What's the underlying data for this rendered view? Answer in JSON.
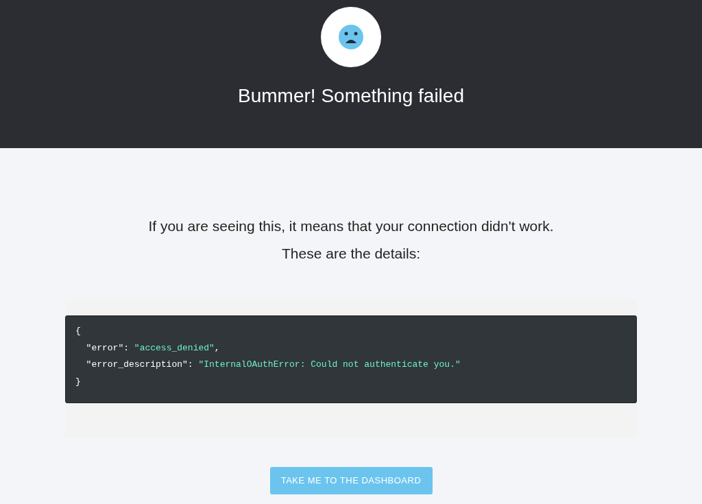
{
  "header": {
    "title": "Bummer! Something failed"
  },
  "message": [
    "If you are seeing this, it means that your connection didn't work.",
    "These are the details:"
  ],
  "code": [
    [
      {
        "kind": "punct",
        "text": "{"
      }
    ],
    [
      {
        "kind": "key",
        "text": "  \"error\""
      },
      {
        "kind": "punct",
        "text": ": "
      },
      {
        "kind": "string",
        "text": "\"access_denied\""
      },
      {
        "kind": "punct",
        "text": ","
      }
    ],
    [
      {
        "kind": "key",
        "text": "  \"error_description\""
      },
      {
        "kind": "punct",
        "text": ": "
      },
      {
        "kind": "string",
        "text": "\"InternalOAuthError: Could not authenticate you.\""
      }
    ],
    [
      {
        "kind": "punct",
        "text": "}"
      }
    ]
  ],
  "button": {
    "label": "TAKE ME TO THE DASHBOARD"
  }
}
